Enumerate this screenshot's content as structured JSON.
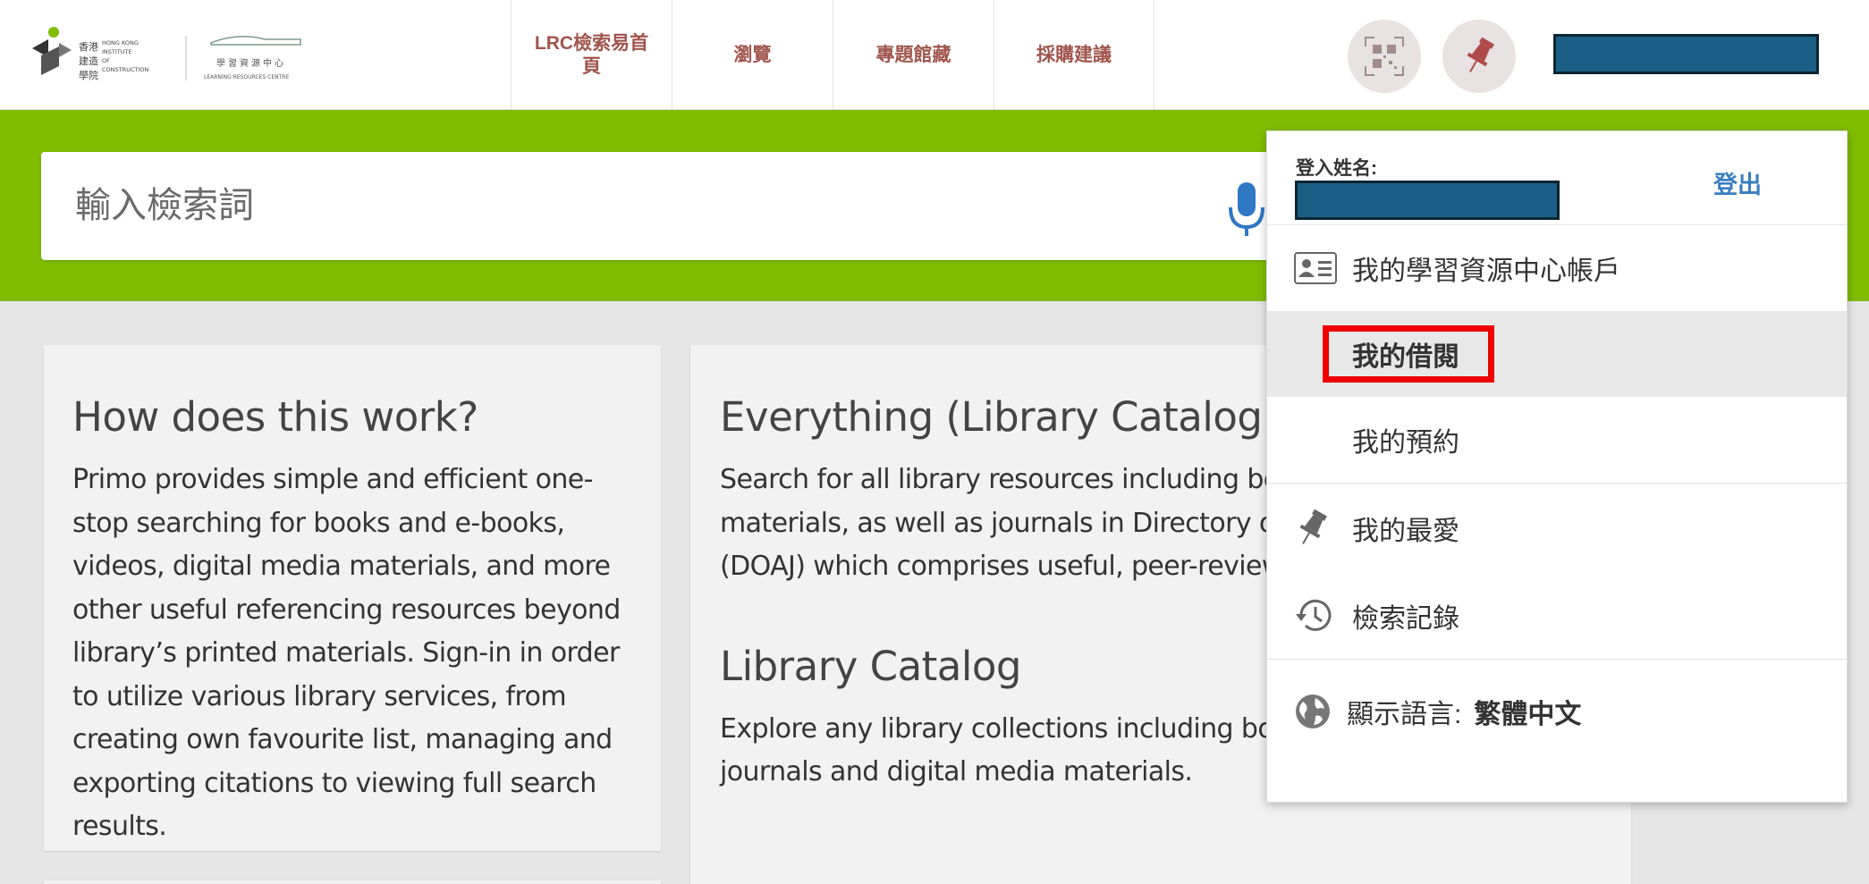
{
  "header": {
    "logo_text": [
      "香港建造學院",
      "HONG KONG INSTITUTE OF CONSTRUCTION",
      "學習資源中心",
      "LEARNING RESOURCES CENTRE"
    ],
    "nav": [
      "LRC檢索易首頁",
      "瀏覽",
      "專題館藏",
      "採購建議"
    ],
    "qr_icon": "qr-code-icon",
    "pin_icon": "pin-icon"
  },
  "search": {
    "placeholder": "輸入檢索詞"
  },
  "cards": {
    "how_title": "How does this work?",
    "how_text": "Primo provides simple and efficient one-stop searching for books and e-books, videos, digital media materials, and more other useful referencing resources beyond library’s printed materials. Sign-in in order to utilize various library services, from creating own favourite list, managing and exporting citations to viewing full search results.",
    "everything_title": "Everything (Library Catalog and",
    "everything_lines": [
      "Search for all library resources including boo",
      "materials, as well as journals in Directory of",
      "(DOAJ) which comprises useful, peer-review"
    ],
    "catalog_title": "Library Catalog",
    "catalog_lines": [
      "Explore any library collections including boo",
      "journals and digital media materials."
    ]
  },
  "dropdown": {
    "login_label": "登入姓名:",
    "logout": "登出",
    "account": "我的學習資源中心帳戶",
    "loans": "我的借閱",
    "requests": "我的預約",
    "favorites": "我的最愛",
    "history": "檢索記錄",
    "language_label": "顯示語言:",
    "language_value": "繁體中文"
  },
  "colors": {
    "banner": "#80bd00",
    "nav_text": "#a0554d",
    "highlight": "#ee0000",
    "redacted": "#1c5f86"
  }
}
